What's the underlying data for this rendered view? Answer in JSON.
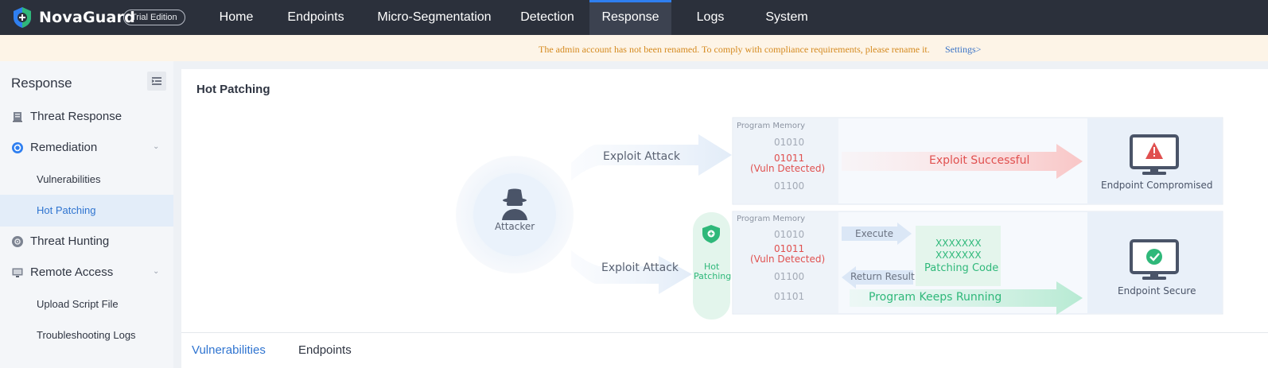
{
  "app": {
    "brand": "NovaGuard",
    "edition_badge": "Trial Edition",
    "colors": {
      "topbar": "#2b303b",
      "accent": "#2f7ff0",
      "warning": "#d58a1f",
      "danger": "#e0504f",
      "success": "#2fb87a"
    }
  },
  "nav": {
    "items": [
      {
        "label": "Home"
      },
      {
        "label": "Endpoints"
      },
      {
        "label": "Micro-Segmentation"
      },
      {
        "label": "Detection"
      },
      {
        "label": "Response",
        "active": true
      },
      {
        "label": "Logs"
      },
      {
        "label": "System"
      }
    ]
  },
  "notice": {
    "text": "The admin account has not been renamed. To comply with compliance requirements, please rename it.",
    "link": "Settings>"
  },
  "sidebar": {
    "title": "Response",
    "items": [
      {
        "label": "Threat Response",
        "icon": "server-icon"
      },
      {
        "label": "Remediation",
        "icon": "remediation-icon",
        "expanded": true
      },
      {
        "label": "Vulnerabilities"
      },
      {
        "label": "Hot Patching",
        "active": true
      },
      {
        "label": "Threat Hunting",
        "icon": "hunting-icon"
      },
      {
        "label": "Remote Access",
        "icon": "monitor-icon",
        "expanded": true
      },
      {
        "label": "Upload Script File"
      },
      {
        "label": "Troubleshooting Logs"
      }
    ]
  },
  "page": {
    "title": "Hot Patching",
    "tabs": [
      {
        "label": "Vulnerabilities",
        "active": true
      },
      {
        "label": "Endpoints"
      }
    ]
  },
  "diagram": {
    "attacker": "Attacker",
    "exploit_attack": "Exploit Attack",
    "hot_patching_line1": "Hot",
    "hot_patching_line2": "Patching",
    "top": {
      "memory_label": "Program Memory",
      "mem1": "01010",
      "mem2": "01011",
      "mem2_note": "(Vuln Detected)",
      "mem3": "01100",
      "result_arrow": "Exploit Successful",
      "endpoint": "Endpoint Compromised"
    },
    "bottom": {
      "memory_label": "Program Memory",
      "mem1": "01010",
      "mem2": "01011",
      "mem2_note": "(Vuln Detected)",
      "mem3": "01100",
      "mem4": "01101",
      "execute": "Execute",
      "return_result": "Return Result",
      "patch_line1": "XXXXXXX",
      "patch_line2": "XXXXXXX",
      "patch_label": "Patching Code",
      "result_arrow": "Program Keeps Running",
      "endpoint": "Endpoint Secure"
    }
  }
}
